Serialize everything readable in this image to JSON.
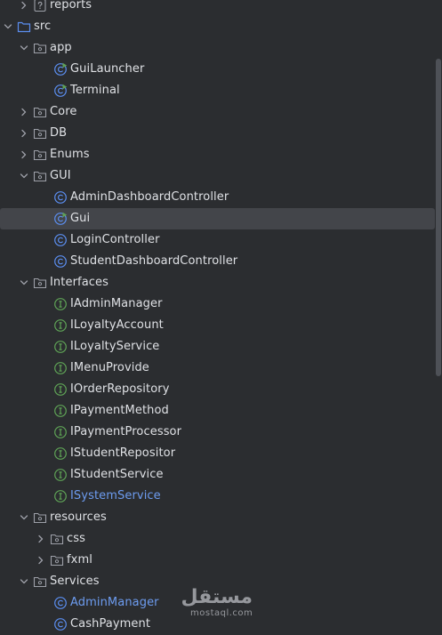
{
  "colors": {
    "background": "#2b2d30",
    "selected_row": "#43454a",
    "text": "#dfe1e5",
    "modified_text": "#6d9cf0",
    "folder_icon": "#9da0a8",
    "class_icon": "#5b8ef0",
    "interface_icon": "#5fa356"
  },
  "tree": {
    "reports": {
      "label": "reports",
      "icon": "unknown-file-icon"
    },
    "src": {
      "label": "src",
      "icon": "source-folder-icon"
    },
    "app": {
      "label": "app",
      "icon": "package-icon"
    },
    "app_items": [
      {
        "label": "GuiLauncher",
        "icon": "runnable-class-icon"
      },
      {
        "label": "Terminal",
        "icon": "runnable-class-icon"
      }
    ],
    "core": {
      "label": "Core",
      "icon": "package-icon"
    },
    "db": {
      "label": "DB",
      "icon": "package-icon"
    },
    "enums": {
      "label": "Enums",
      "icon": "package-icon"
    },
    "gui": {
      "label": "GUI",
      "icon": "package-icon"
    },
    "gui_items": [
      {
        "label": "AdminDashboardController",
        "icon": "class-icon"
      },
      {
        "label": "Gui",
        "icon": "runnable-class-icon"
      },
      {
        "label": "LoginController",
        "icon": "class-icon"
      },
      {
        "label": "StudentDashboardController",
        "icon": "class-icon"
      }
    ],
    "interfaces": {
      "label": "Interfaces",
      "icon": "package-icon"
    },
    "interface_items": [
      {
        "label": "IAdminManager"
      },
      {
        "label": "ILoyaltyAccount"
      },
      {
        "label": "ILoyaltyService"
      },
      {
        "label": "IMenuProvide"
      },
      {
        "label": "IOrderRepository"
      },
      {
        "label": "IPaymentMethod"
      },
      {
        "label": "IPaymentProcessor"
      },
      {
        "label": "IStudentRepositor"
      },
      {
        "label": "IStudentService"
      },
      {
        "label": "ISystemService"
      }
    ],
    "resources": {
      "label": "resources",
      "icon": "package-icon"
    },
    "css": {
      "label": "css",
      "icon": "package-icon"
    },
    "fxml": {
      "label": "fxml",
      "icon": "package-icon"
    },
    "services": {
      "label": "Services",
      "icon": "package-icon"
    },
    "services_items": [
      {
        "label": "AdminManager",
        "icon": "class-icon"
      },
      {
        "label": "CashPayment",
        "icon": "class-icon"
      }
    ]
  },
  "watermark": {
    "arabic": "مستقل",
    "latin": "mostaql.com"
  }
}
